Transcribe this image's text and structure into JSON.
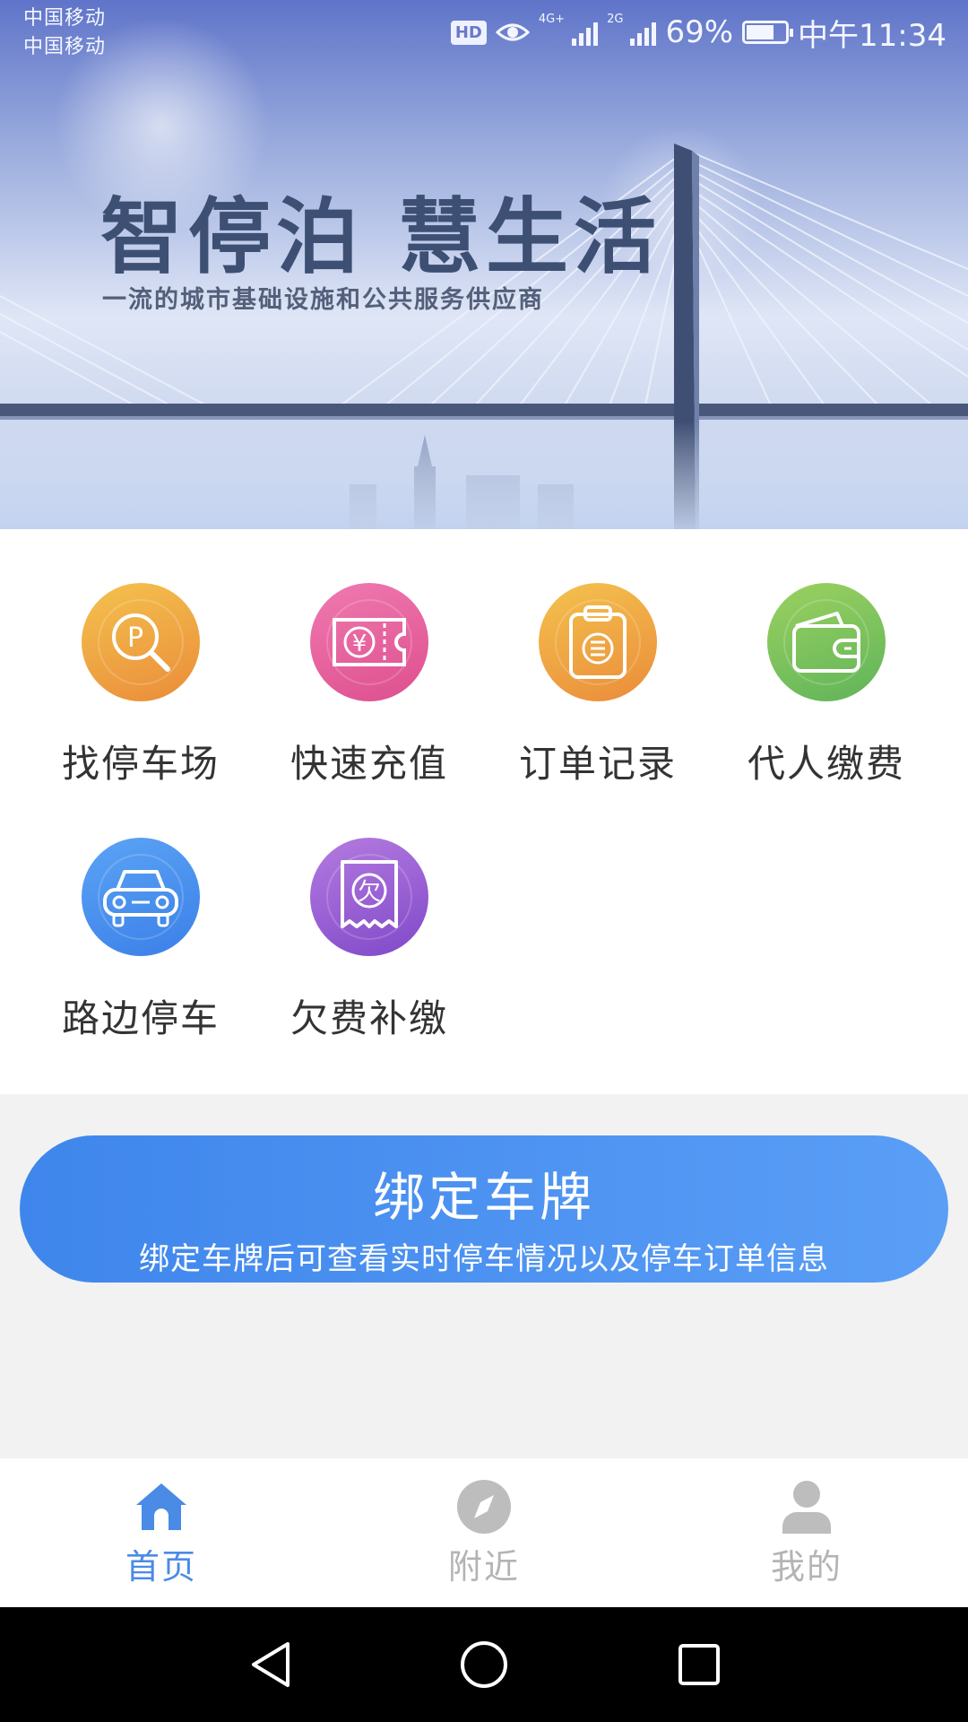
{
  "status_bar": {
    "carrier_1": "中国移动",
    "carrier_2": "中国移动",
    "hd_badge": "HD",
    "network_1": "4G+",
    "network_2": "2G",
    "battery_percent": "69%",
    "battery_level": 0.69,
    "time": "中午11:34"
  },
  "banner": {
    "title": "智停泊 慧生活",
    "subtitle": "一流的城市基础设施和公共服务供应商"
  },
  "menu": {
    "items": [
      {
        "label": "找停车场",
        "icon": "parking-search-icon",
        "color": "#f0a843"
      },
      {
        "label": "快速充值",
        "icon": "yuan-ticket-icon",
        "color": "#e75f9c"
      },
      {
        "label": "订单记录",
        "icon": "clipboard-icon",
        "color": "#f0a843"
      },
      {
        "label": "代人缴费",
        "icon": "wallet-icon",
        "color": "#7cc35c"
      },
      {
        "label": "路边停车",
        "icon": "car-icon",
        "color": "#4a91ee"
      },
      {
        "label": "欠费补缴",
        "icon": "arrears-receipt-icon",
        "color": "#9a61d4"
      }
    ],
    "arrears_glyph": "欠",
    "yuan_glyph": "¥",
    "parking_glyph": "P"
  },
  "bind_plate": {
    "title": "绑定车牌",
    "description": "绑定车牌后可查看实时停车情况以及停车订单信息"
  },
  "tabs": [
    {
      "label": "首页",
      "icon": "home-icon",
      "active": true
    },
    {
      "label": "附近",
      "icon": "compass-icon",
      "active": false
    },
    {
      "label": "我的",
      "icon": "user-icon",
      "active": false
    }
  ],
  "colors": {
    "accent": "#4a8be6",
    "tab_inactive": "#b4b4b4"
  }
}
